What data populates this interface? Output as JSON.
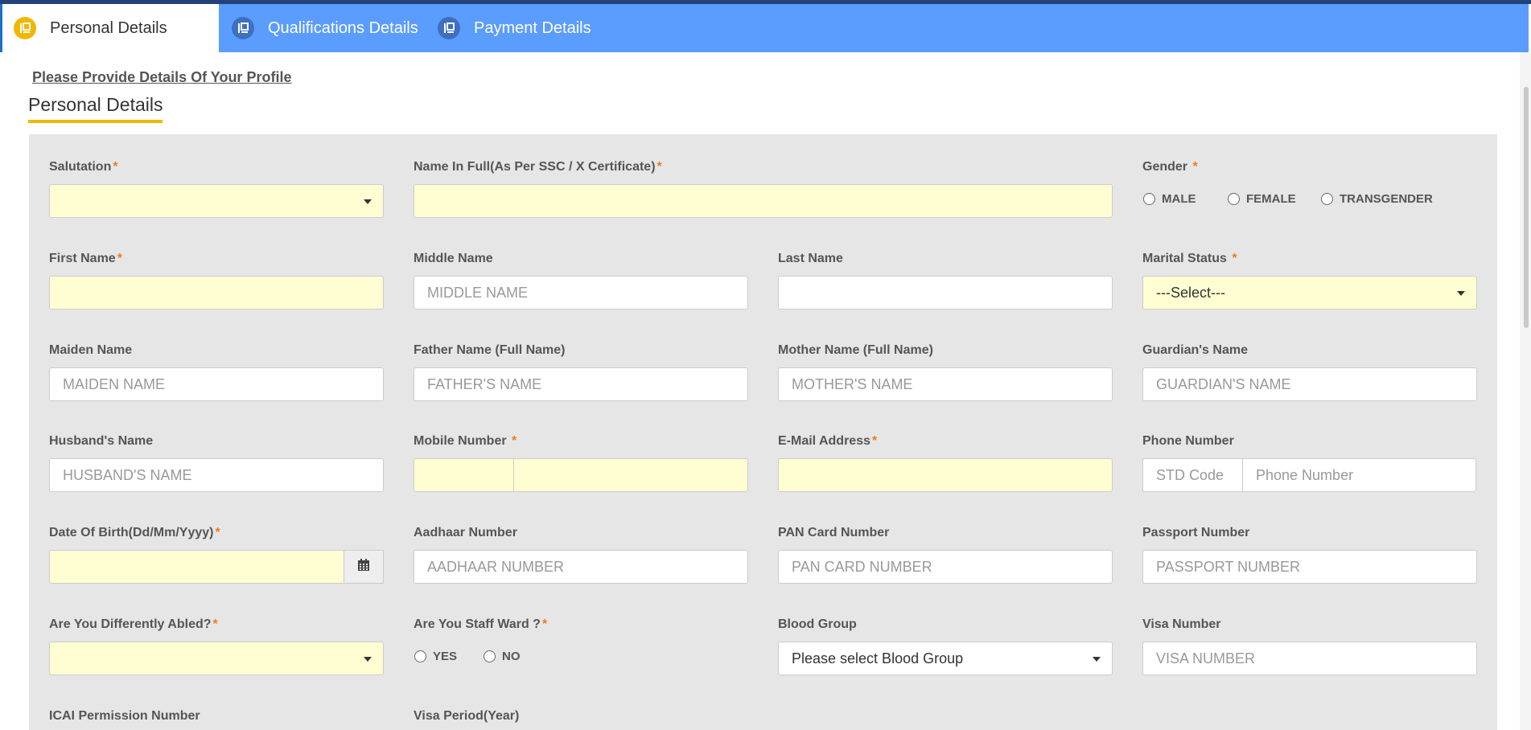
{
  "tabs": [
    {
      "label": "Personal Details",
      "icon": "form-icon",
      "active": true
    },
    {
      "label": "Qualifications Details",
      "icon": "form-icon",
      "active": false
    },
    {
      "label": "Payment Details",
      "icon": "form-icon",
      "active": false
    }
  ],
  "profile_link": "Please Provide Details Of Your Profile",
  "section_title": "Personal Details",
  "colors": {
    "tab_bar": "#5b9cff",
    "accent": "#f1b600",
    "required": "#ee7c1c",
    "required_field_bg": "#fefed2",
    "panel_bg": "#e6e6e6"
  },
  "fields": {
    "salutation": {
      "label": "Salutation",
      "req": "*",
      "value": ""
    },
    "full_name": {
      "label": "Name In Full(As Per SSC / X Certificate)",
      "req": "*",
      "value": ""
    },
    "gender": {
      "label": "Gender",
      "req": "*",
      "options": [
        "MALE",
        "FEMALE",
        "TRANSGENDER"
      ]
    },
    "first_name": {
      "label": "First Name",
      "req": "*",
      "value": ""
    },
    "middle_name": {
      "label": "Middle Name",
      "placeholder": "MIDDLE NAME"
    },
    "last_name": {
      "label": "Last Name",
      "placeholder": ""
    },
    "marital_status": {
      "label": "Marital Status",
      "req": "*",
      "value": "---Select---"
    },
    "maiden_name": {
      "label": "Maiden Name",
      "placeholder": "MAIDEN NAME"
    },
    "father_name": {
      "label": "Father Name (Full Name)",
      "placeholder": "FATHER'S NAME"
    },
    "mother_name": {
      "label": "Mother Name (Full Name)",
      "placeholder": "MOTHER'S NAME"
    },
    "guardian_name": {
      "label": "Guardian's Name",
      "placeholder": "GUARDIAN'S NAME"
    },
    "husband_name": {
      "label": "Husband's Name",
      "placeholder": "HUSBAND'S NAME"
    },
    "mobile": {
      "label": "Mobile Number",
      "req": "*"
    },
    "email": {
      "label": "E-Mail Address",
      "req": "*"
    },
    "phone": {
      "label": "Phone Number",
      "std_placeholder": "STD Code",
      "num_placeholder": "Phone Number"
    },
    "dob": {
      "label": "Date Of Birth(Dd/Mm/Yyyy)",
      "req": "*",
      "icon": "calendar-icon"
    },
    "aadhaar": {
      "label": "Aadhaar Number",
      "placeholder": "AADHAAR NUMBER"
    },
    "pan": {
      "label": "PAN Card Number",
      "placeholder": "PAN CARD NUMBER"
    },
    "passport": {
      "label": "Passport Number",
      "placeholder": "PASSPORT NUMBER"
    },
    "differently_abled": {
      "label": "Are You Differently Abled?",
      "req": "*",
      "value": ""
    },
    "staff_ward": {
      "label": "Are You Staff Ward ?",
      "req": "*",
      "options": [
        "YES",
        "NO"
      ]
    },
    "blood_group": {
      "label": "Blood Group",
      "value": "Please select Blood Group"
    },
    "visa_number": {
      "label": "Visa Number",
      "placeholder": "VISA NUMBER"
    },
    "icai_permission": {
      "label": "ICAI Permission Number"
    },
    "visa_period": {
      "label": "Visa Period(Year)"
    }
  }
}
